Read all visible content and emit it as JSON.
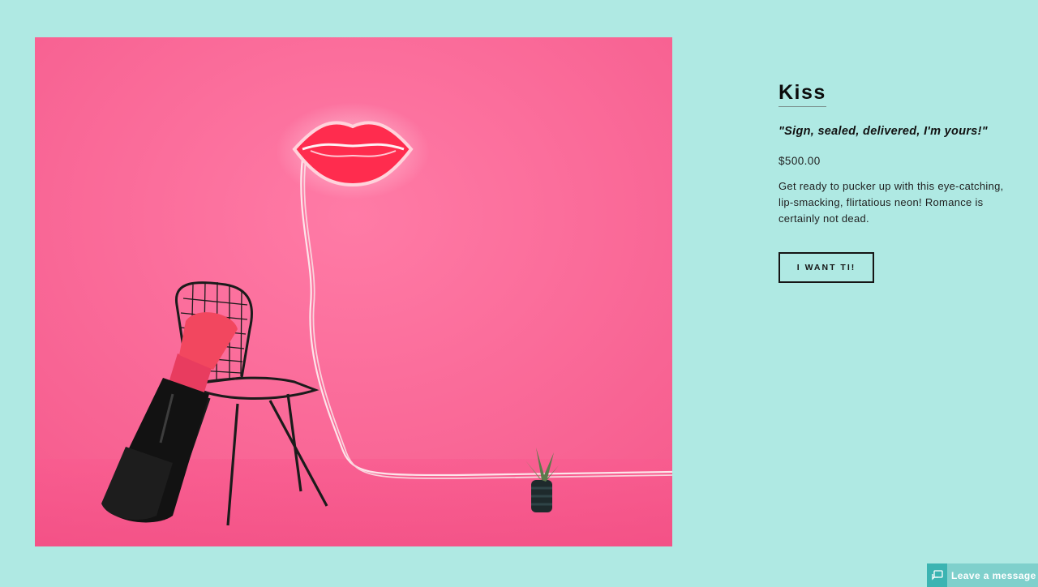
{
  "product": {
    "title": "Kiss",
    "tagline": "\"Sign, sealed, delivered, I'm yours!\"",
    "price": "$500.00",
    "description": "Get ready to pucker up with this eye-catching, lip-smacking, flirtatious neon! Romance is certainly not dead.",
    "button_label": "I WANT TI!"
  },
  "chat": {
    "label": "Leave a message",
    "icon": "chat-bubble-icon"
  },
  "colors": {
    "page_background": "#afe9e3",
    "photo_background": "#fb6a98",
    "neon_red": "#ff2c4e",
    "chat_accent": "#3bb4b2"
  }
}
